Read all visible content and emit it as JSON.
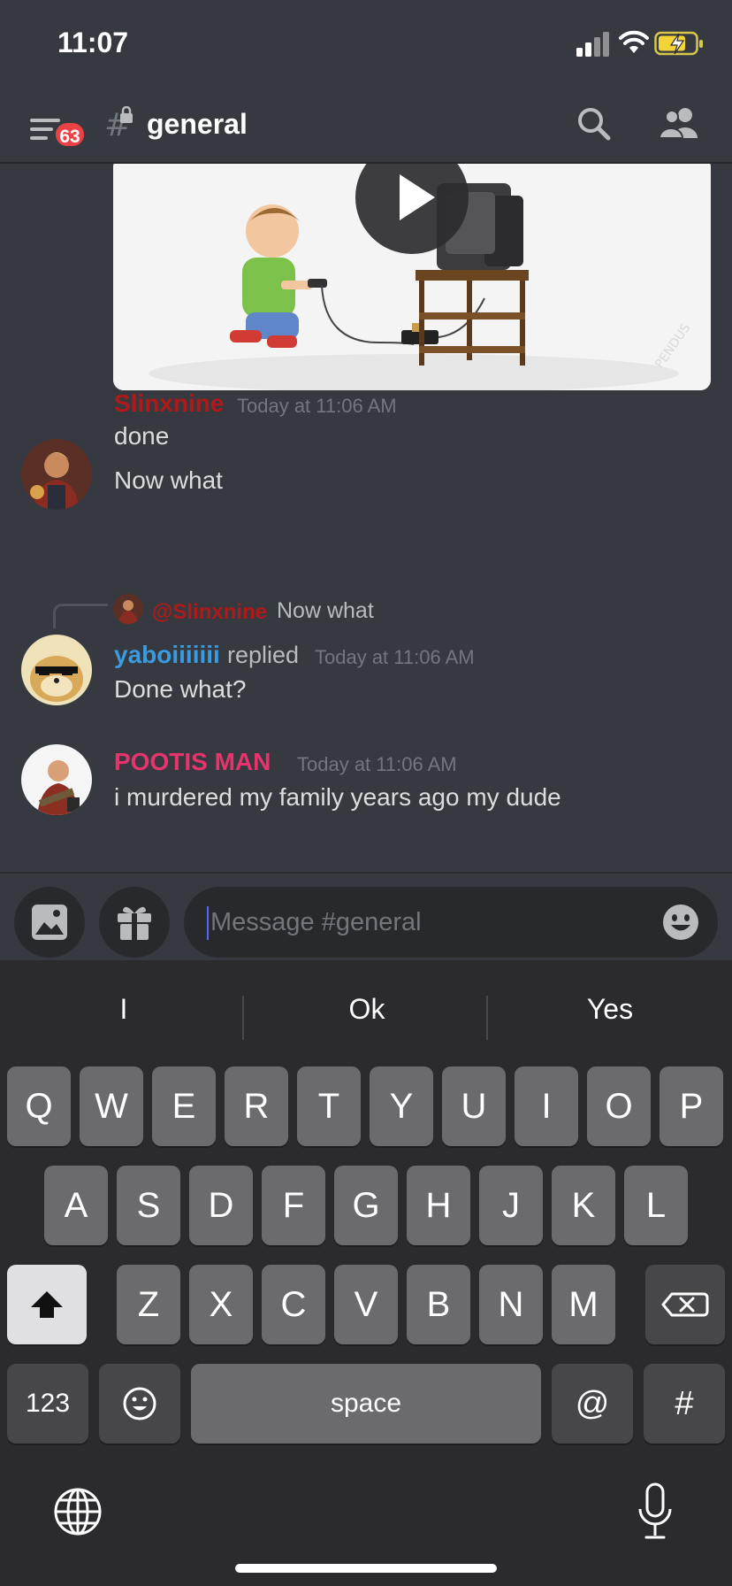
{
  "status_bar": {
    "time": "11:07"
  },
  "header": {
    "notification_count": "63",
    "channel_name": "general"
  },
  "messages": [
    {
      "author": "Slinxnine",
      "author_color": "#b01919",
      "timestamp": "Today at 11:06 AM",
      "lines": [
        "done",
        "Now what"
      ]
    },
    {
      "reply_to": {
        "author": "@Slinxnine",
        "text": "Now what"
      },
      "author": "yaboiiiiiii",
      "author_color": "#3b9be0",
      "replied_label": "replied",
      "timestamp": "Today at 11:06 AM",
      "lines": [
        "Done what?"
      ]
    },
    {
      "author": "POOTIS MAN",
      "author_color": "#e8336d",
      "timestamp": "Today at 11:06 AM",
      "lines": [
        "i murdered my family years ago my dude"
      ]
    }
  ],
  "composer": {
    "placeholder": "Message #general"
  },
  "keyboard": {
    "suggestions": [
      "I",
      "Ok",
      "Yes"
    ],
    "row1": [
      "Q",
      "W",
      "E",
      "R",
      "T",
      "Y",
      "U",
      "I",
      "O",
      "P"
    ],
    "row2": [
      "A",
      "S",
      "D",
      "F",
      "G",
      "H",
      "J",
      "K",
      "L"
    ],
    "row3": [
      "Z",
      "X",
      "C",
      "V",
      "B",
      "N",
      "M"
    ],
    "numbers_key": "123",
    "space_key": "space",
    "at_key": "@",
    "hash_key": "#"
  },
  "colors": {
    "background": "#36393f",
    "badge": "#ed4245",
    "keyboard_bg": "#2b2b2d",
    "key": "#6b6b6e"
  }
}
